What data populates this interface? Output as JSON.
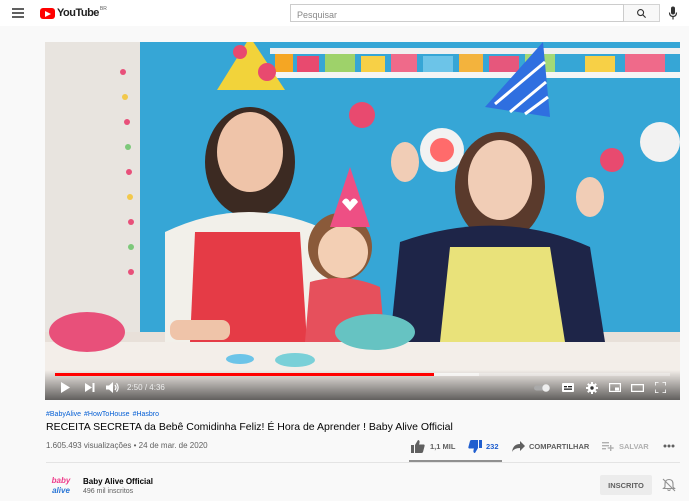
{
  "masthead": {
    "logo_text": "YouTube",
    "region": "BR",
    "search_placeholder": "Pesquisar"
  },
  "player": {
    "current_time": "2:50",
    "duration": "4:36",
    "progress_played": 0.616,
    "progress_loaded": 0.69,
    "accent_color": "#ff0000"
  },
  "video": {
    "hashtags": [
      "#BabyAlive",
      "#HowToHouse",
      "#Hasbro"
    ],
    "title": "RECEITA SECRETA da Bebê Comidinha Feliz! É Hora de Aprender ! Baby Alive Official",
    "views": "1.605.493 visualizações",
    "date": "24 de mar. de 2020",
    "likes": "1,1 MIL",
    "dislikes": "232",
    "share_label": "COMPARTILHAR",
    "save_label": "SALVAR"
  },
  "channel": {
    "name": "Baby Alive Official",
    "subscribers": "496 mil inscritos",
    "subscribed_label": "INSCRITO",
    "avatar_text": "baby alive"
  },
  "icons": [
    "menu-icon",
    "search-icon",
    "mic-icon",
    "play-icon",
    "next-icon",
    "volume-icon",
    "autoplay-toggle",
    "subtitles-icon",
    "settings-icon",
    "miniplayer-icon",
    "theater-icon",
    "fullscreen-icon",
    "like-icon",
    "dislike-icon",
    "share-icon",
    "save-icon",
    "more-icon",
    "bell-icon"
  ]
}
